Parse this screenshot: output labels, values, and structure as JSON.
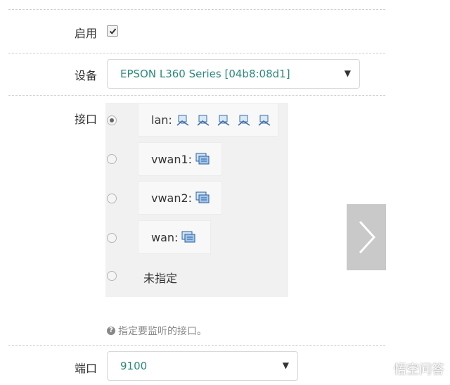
{
  "form": {
    "enable": {
      "label": "启用",
      "checked": true
    },
    "device": {
      "label": "设备",
      "value": "EPSON L360 Series [04b8:08d1]"
    },
    "interface": {
      "label": "接口",
      "options": [
        {
          "name": "lan:",
          "icon": "wired-network-icon",
          "icon_count": 5,
          "selected": true
        },
        {
          "name": "vwan1:",
          "icon": "wireless-network-icon",
          "selected": false
        },
        {
          "name": "vwan2:",
          "icon": "wireless-network-icon",
          "selected": false
        },
        {
          "name": "wan:",
          "icon": "wireless-network-icon",
          "selected": false
        },
        {
          "name": "未指定",
          "selected": false
        }
      ],
      "help": "指定要监听的接口。"
    },
    "port": {
      "label": "端口",
      "value": "9100"
    }
  },
  "nav": {
    "next_icon": "chevron-right-icon"
  },
  "watermark": {
    "text": "悟空问答"
  }
}
